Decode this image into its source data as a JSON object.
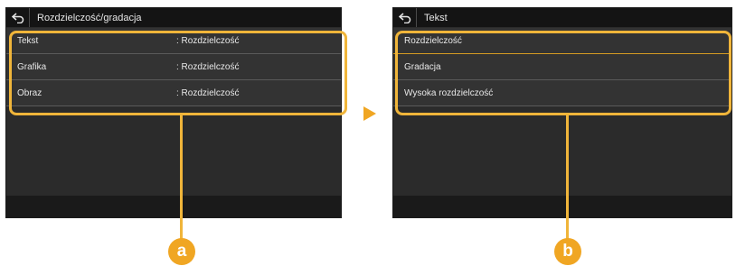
{
  "left_screen": {
    "title": "Rozdzielczość/gradacja",
    "rows": [
      {
        "label": "Tekst",
        "value": ": Rozdzielczość"
      },
      {
        "label": "Grafika",
        "value": ": Rozdzielczość"
      },
      {
        "label": "Obraz",
        "value": ": Rozdzielczość"
      }
    ]
  },
  "right_screen": {
    "title": "Tekst",
    "rows": [
      {
        "label": "Rozdzielczość"
      },
      {
        "label": "Gradacja"
      },
      {
        "label": "Wysoka rozdzielczość"
      }
    ]
  },
  "callouts": {
    "a": "a",
    "b": "b"
  },
  "colors": {
    "accent": "#f0a623",
    "screen_bg": "#2b2b2b",
    "titlebar_bg": "#141414"
  },
  "icons": {
    "back": "back-arrow-icon",
    "next": "right-triangle-arrow-icon"
  }
}
